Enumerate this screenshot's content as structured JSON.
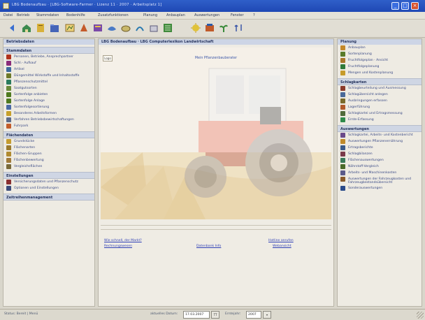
{
  "window": {
    "title": "LBG Bodenaufbau · [LBG-Software-Farmer · Lizenz 11 · 2007 · Arbeitsplatz 1]",
    "buttons": {
      "minimize": "_",
      "maximize": "□",
      "close": "×"
    }
  },
  "menu": [
    "Datei",
    "Betrieb",
    "Stammdaten",
    "Bodenhilfe",
    "Zusatzfunktionen",
    "Planung",
    "Anbauplan",
    "Auswertungen",
    "Fenster",
    "?"
  ],
  "toolbar": {
    "icons": [
      "back-icon",
      "home-icon",
      "book-icon",
      "folder-icon",
      "seed-icon",
      "calendar-icon",
      "drop-icon",
      "leaf-icon",
      "bell-icon",
      "grid-icon",
      "sun-icon",
      "document-icon",
      "box-icon",
      "tools-icon",
      "arrow-icon"
    ]
  },
  "left_panel": {
    "title": "Betriebsdaten",
    "sections": [
      {
        "title": "Stammdaten",
        "items": [
          {
            "label": "Personen, Betriebe, Ansprechpartner",
            "icon": "user-icon",
            "color": "#b0331c"
          },
          {
            "label": "Schl.- Aufkauf",
            "icon": "tag-icon",
            "color": "#8a2b7a"
          },
          {
            "label": "Artikel",
            "icon": "wrench-icon",
            "color": "#3e6b9e"
          },
          {
            "label": "Düngemittel Wirkstoffe und Inhaltsstoffe",
            "icon": "bag-icon",
            "color": "#6e7a2a"
          },
          {
            "label": "Pflanzenschutzmittel",
            "icon": "bottle-icon",
            "color": "#2a7b5d"
          },
          {
            "label": "Saatgutsorten",
            "icon": "seed-icon",
            "color": "#6a8a3a"
          },
          {
            "label": "Sortenfolge anbieten",
            "icon": "sprout-icon",
            "color": "#4f7a1f"
          },
          {
            "label": "Sortenfolge Anlage",
            "icon": "sprout-icon",
            "color": "#4f7a1f"
          },
          {
            "label": "Sortenfolgesortierung",
            "icon": "list-icon",
            "color": "#4a6aa4"
          },
          {
            "label": "Besonderes Arbeitsformen",
            "icon": "star-icon",
            "color": "#c7a02a"
          },
          {
            "label": "Verfahren Betriebsbewirtschaftungen",
            "icon": "gear-icon",
            "color": "#5c6b8a"
          },
          {
            "label": "Fuhrpark",
            "icon": "tractor-icon",
            "color": "#c25d2b"
          }
        ]
      },
      {
        "title": "Flächendaten",
        "items": [
          {
            "label": "Grundstücke",
            "icon": "map-icon",
            "color": "#c59c2f"
          },
          {
            "label": "Flächenarten",
            "icon": "field-icon",
            "color": "#9a7a2e"
          },
          {
            "label": "Flächen-Gruppen",
            "icon": "group-icon",
            "color": "#b08a2f"
          },
          {
            "label": "Flächenbewertung",
            "icon": "ruler-icon",
            "color": "#a07a3a"
          },
          {
            "label": "Vergleichsflächen",
            "icon": "compare-icon",
            "color": "#7a6a3a"
          }
        ]
      },
      {
        "title": "Einstellungen",
        "items": [
          {
            "label": "Versicherungsdaten und Pflanzenschutz",
            "icon": "shield-icon",
            "color": "#8a3030"
          },
          {
            "label": "Optionen und Einstellungen",
            "icon": "options-icon",
            "color": "#3c4d7c"
          }
        ]
      },
      {
        "title": "Zeitreihenmanagement",
        "items": []
      }
    ]
  },
  "center": {
    "title": "LBG Bodenaufbau · LBG Computerlexikon Landwirtschaft",
    "logo_button": "Logo",
    "frame_heading": "Mein Pflanzenbauberater",
    "links": {
      "left_top": "Wie schnell, der Markt?",
      "left_bottom": "Rechnungswesen",
      "middle": "Datenbank Info",
      "right_top": "Hotline anrufen",
      "right_bottom": "Webansicht"
    }
  },
  "right_panel": {
    "title": "Planung",
    "sections": [
      {
        "title": null,
        "items": [
          {
            "label": "Anbauplan",
            "icon": "plan-icon",
            "color": "#c3882a"
          },
          {
            "label": "Sortenplanung",
            "icon": "pencil-icon",
            "color": "#5a7b2a"
          },
          {
            "label": "Fruchtfolgeplan · Ansicht",
            "icon": "rotate-icon",
            "color": "#a9772a"
          },
          {
            "label": "Fruchtfolgeplanung",
            "icon": "cycle-icon",
            "color": "#2f7a3a"
          },
          {
            "label": "Mengen und Kostenplanung",
            "icon": "coins-icon",
            "color": "#c79b2a"
          }
        ]
      },
      {
        "title": "Schlagkarten",
        "items": [
          {
            "label": "Schlagbeurteilung und Ausmessung",
            "icon": "pen-icon",
            "color": "#8a3a2a"
          },
          {
            "label": "Schlagübersicht anlegen",
            "icon": "brush-icon",
            "color": "#4a6a9a"
          },
          {
            "label": "Ausbringungen erfassen",
            "icon": "spread-icon",
            "color": "#7a6a2a"
          },
          {
            "label": "Lagerführung",
            "icon": "warehouse-icon",
            "color": "#b05a2a"
          },
          {
            "label": "Schlagkartei und Ertragsmessung",
            "icon": "notebook-icon",
            "color": "#4f6a3a"
          },
          {
            "label": "Ernte-Erfassung",
            "icon": "harvest-icon",
            "color": "#2f8a4a"
          }
        ]
      },
      {
        "title": "Auswertungen",
        "items": [
          {
            "label": "Schlagkartei, Arbeits- und Kostenbericht",
            "icon": "report-icon",
            "color": "#6a4a8a"
          },
          {
            "label": "Auswertungen Pflanzenernährung",
            "icon": "chart-icon",
            "color": "#c08a2a"
          },
          {
            "label": "Ertragsberichte",
            "icon": "table-icon",
            "color": "#3a5a8a"
          },
          {
            "label": "Schlagbilanzen",
            "icon": "balance-icon",
            "color": "#7a3a4a"
          },
          {
            "label": "Flächenauswertungen",
            "icon": "area-icon",
            "color": "#3a7a5a"
          },
          {
            "label": "Nährstoff-Vergleich",
            "icon": "compare-icon",
            "color": "#4a6a2a"
          },
          {
            "label": "Arbeits- und Maschinenkosten",
            "icon": "clock-icon",
            "color": "#5a5a8a"
          },
          {
            "label": "Auswertungen der Fahrzeugkosten und Fahrzeugbestandsübersicht",
            "icon": "truck-icon",
            "color": "#8a5a2a"
          },
          {
            "label": "Sonderauswertungen",
            "icon": "special-icon",
            "color": "#2a4a8a"
          }
        ]
      }
    ]
  },
  "status": {
    "left": "Status: Bereit | Menü",
    "date_label": "aktuelles Datum:",
    "date_value": "17.03.2007",
    "date_btn": "TT",
    "year_label": "Erntejahr:",
    "year_value": "2007"
  }
}
